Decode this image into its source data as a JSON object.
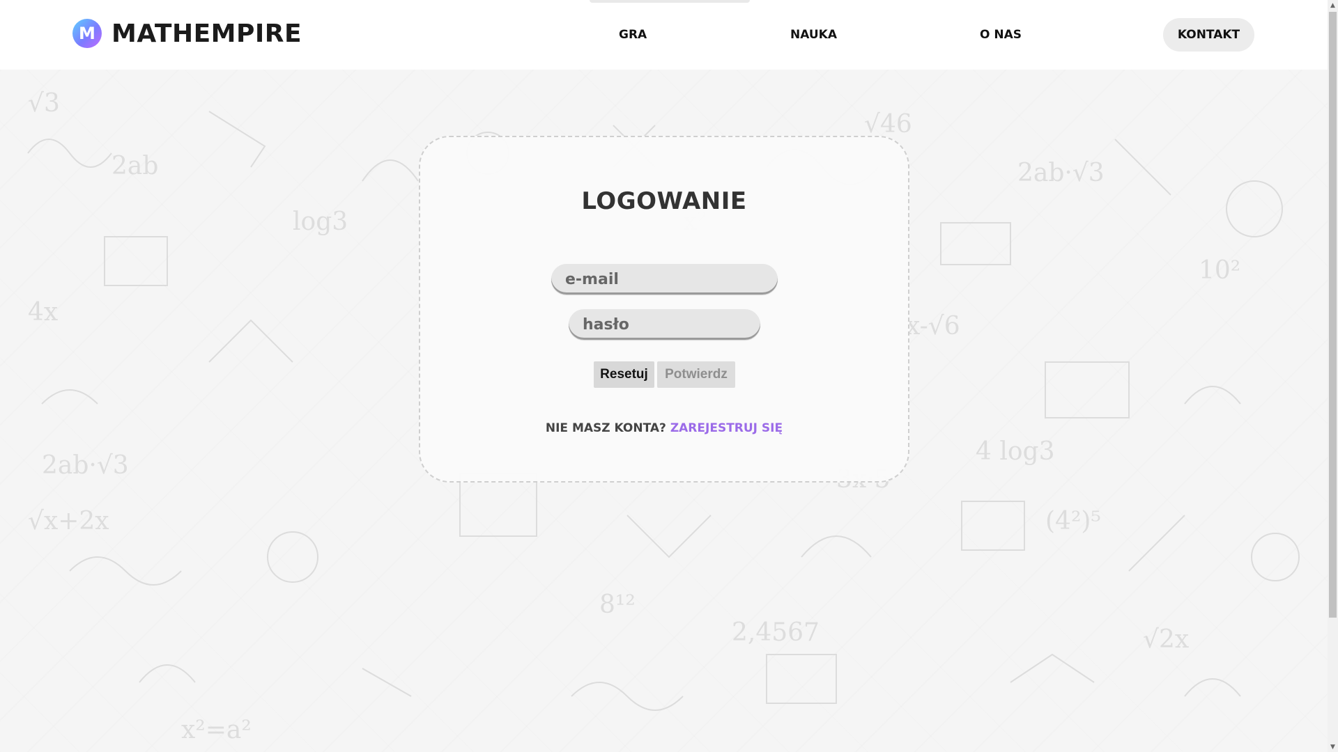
{
  "brand": {
    "name": "MATHEMPIRE",
    "icon": "mathempire-logo-icon",
    "icon_letter": "M"
  },
  "nav": {
    "items": [
      {
        "label": "GRA"
      },
      {
        "label": "NAUKA"
      },
      {
        "label": "O NAS"
      }
    ],
    "contact_label": "KONTAKT"
  },
  "login": {
    "title": "LOGOWANIE",
    "email_placeholder": "e-mail",
    "email_value": "",
    "password_placeholder": "hasło",
    "password_value": "",
    "reset_label": "Resetuj",
    "confirm_label": "Potwierdz",
    "no_account_text": "NIE MASZ KONTA?",
    "register_link": "ZAREJESTRUJ SIĘ"
  },
  "colors": {
    "accent_link": "#9b6be8",
    "text_dark": "#111111",
    "card_border": "#cfcfcf"
  }
}
